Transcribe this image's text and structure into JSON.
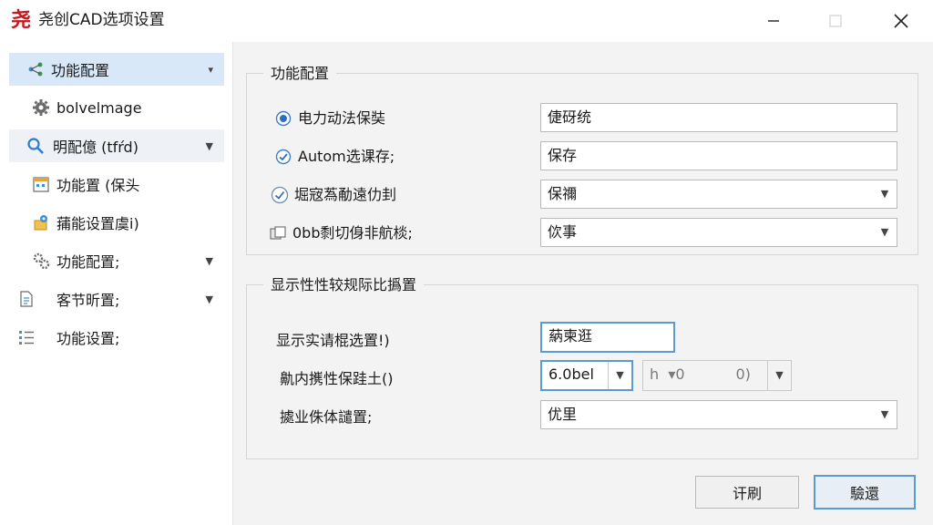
{
  "window": {
    "logo_text": "尧",
    "title": "尧创CAD选项设置"
  },
  "sidebar": {
    "items": [
      {
        "label": "功能配置",
        "icon": "share-node-icon",
        "caret": "▾"
      },
      {
        "label": "bolvelmage",
        "icon": "gear-icon"
      },
      {
        "label": "明配億 (tfŕd)",
        "icon": "search-icon",
        "caret": "▼"
      },
      {
        "label": "功能置 (保头",
        "icon": "calendar-icon"
      },
      {
        "label": "蒱能设置虞i)",
        "icon": "pin-folder-icon"
      },
      {
        "label": "功能配置;",
        "icon": "cogs-icon",
        "caret": "▼"
      },
      {
        "label": "客节昕置;",
        "icon": "document-icon",
        "caret": "▼"
      },
      {
        "label": "功能设置;",
        "icon": "list-icon"
      }
    ]
  },
  "group1": {
    "title": "功能配置",
    "rows": [
      {
        "label": "电力动法保奘",
        "value": "倢砑统"
      },
      {
        "label": "Autom选课存;",
        "value": "保存"
      },
      {
        "label": "堀宼蒍勈遠仂刲",
        "value": "保禰"
      },
      {
        "label": "0bb㓿切㑗非航棪;",
        "value": "佽事"
      }
    ]
  },
  "group2": {
    "title": "显示性性较规际比撝置",
    "rows": [
      {
        "label": "显示实请棍选置!)",
        "value": "蒳柬逛"
      },
      {
        "label": "鼽内㩗性保跬土()",
        "value": "6.0bel",
        "value2": "h  ▾0           0)"
      },
      {
        "label": "㨿业侏体譴置;",
        "value": "优里"
      }
    ]
  },
  "buttons": {
    "secondary": "讦刷",
    "primary": "驗還"
  },
  "colors": {
    "accent": "#5b9bd5",
    "selected_bg": "#d9e8f9",
    "logo": "#c8161d"
  }
}
